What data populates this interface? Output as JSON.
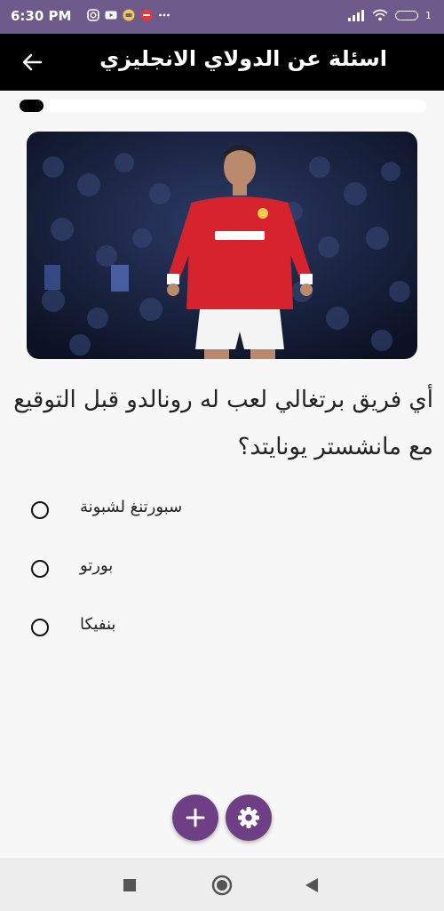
{
  "status_bar": {
    "time": "6:30 PM",
    "left_icons": [
      "instagram-icon",
      "youtube-icon",
      "app-icon",
      "app-icon-red",
      "more-dots-icon"
    ],
    "right_icons": [
      "signal-icon",
      "wifi-icon",
      "battery-icon"
    ],
    "battery_level": "1",
    "background": "#6f5a8c"
  },
  "app_bar": {
    "title": "اسئلة عن الدولاي الانجليزي",
    "back_icon": "arrow-left-icon",
    "background": "#000000"
  },
  "progress": {
    "fraction": 0.06
  },
  "question": {
    "text": "أي فريق برتغالي لعب له رونالدو قبل التوقيع مع مانشستر يونايتد؟"
  },
  "options": [
    {
      "label": "سبورتنغ لشبونة"
    },
    {
      "label": "بورتو"
    },
    {
      "label": "بنفيكا"
    }
  ],
  "fabs": {
    "add_icon": "plus-icon",
    "settings_icon": "gear-icon",
    "color": "#6f3f86"
  },
  "nav_bar": {
    "icons": [
      "recent-apps-square-icon",
      "home-circle-icon",
      "back-triangle-icon"
    ]
  }
}
